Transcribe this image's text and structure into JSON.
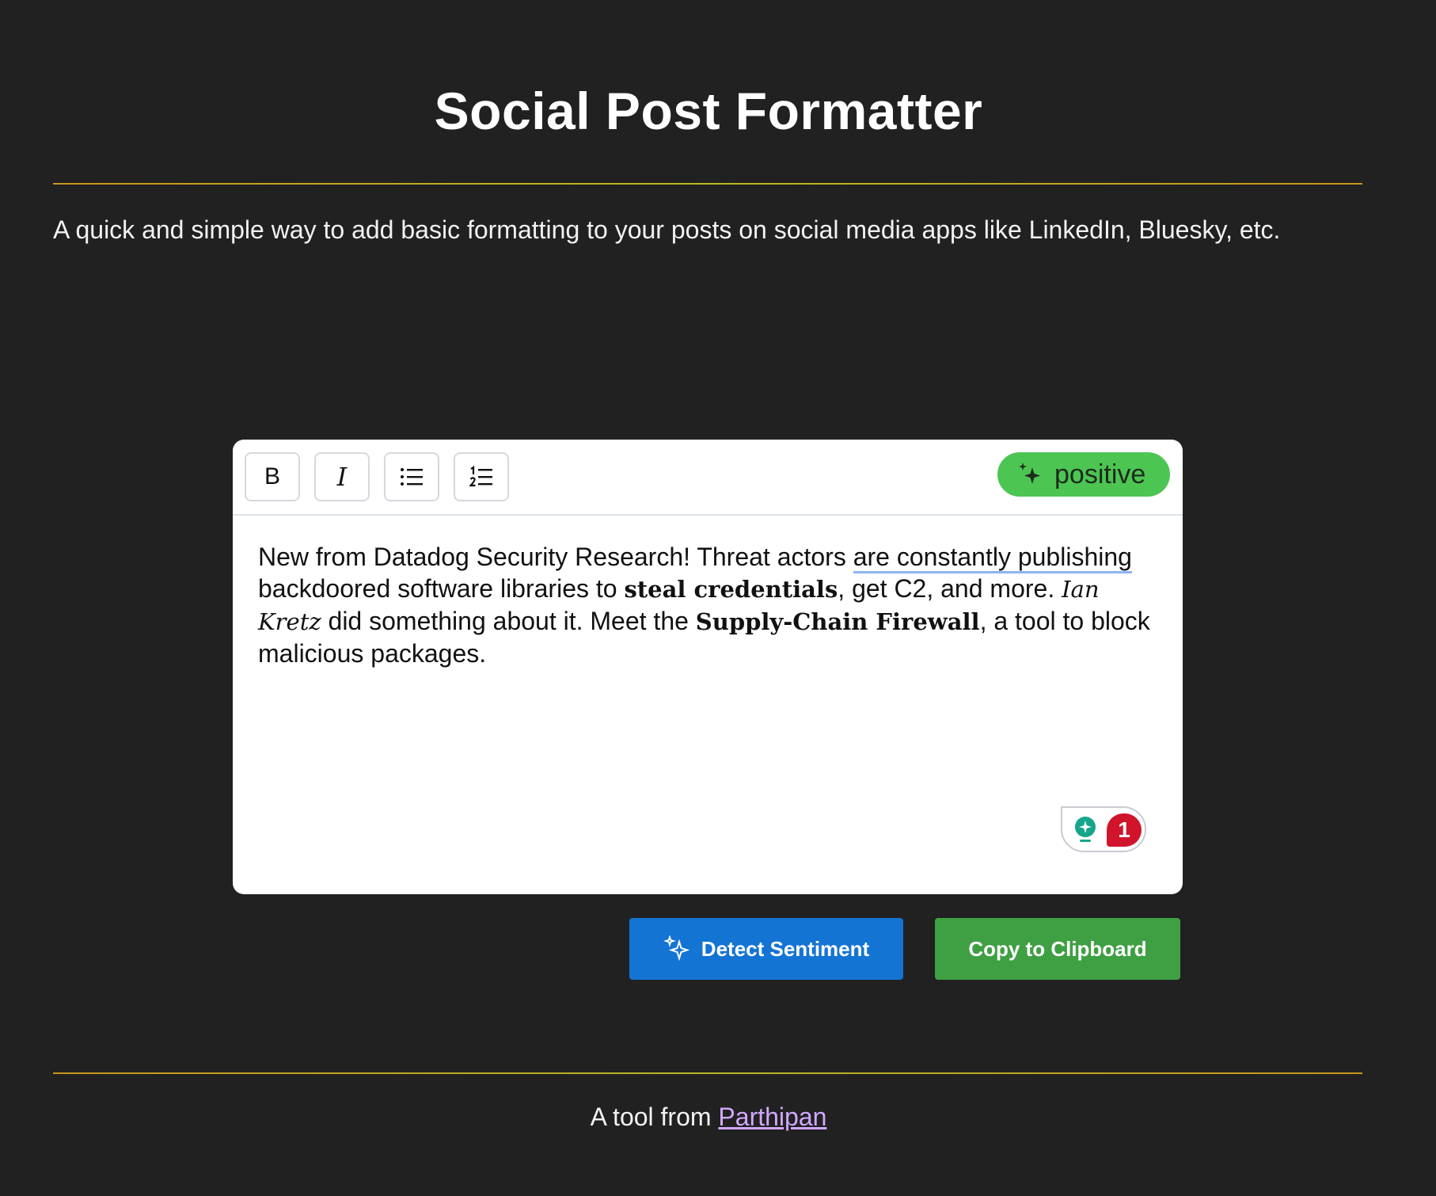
{
  "header": {
    "title": "Social Post Formatter",
    "subtitle": "A quick and simple way to add basic formatting to your posts on social media apps like LinkedIn, Bluesky, etc."
  },
  "toolbar": {
    "bold_label": "B",
    "italic_label": "I",
    "bulleted_list_icon": "bulleted-list-icon",
    "numbered_list_icon": "numbered-list-icon"
  },
  "sentiment": {
    "label": "positive",
    "icon": "sparkle-icon",
    "color": "#4cc552"
  },
  "editor": {
    "segments": [
      "New from Datadog Security Research! Threat actors ",
      "are constantly publishing",
      " backdoored software libraries to ",
      "steal credentials",
      ", get C2, and more. ",
      "Ian Kretz",
      " did something about it. Meet the ",
      "Supply-Chain Firewall",
      ", a tool to block malicious packages."
    ]
  },
  "grammar_widget": {
    "icon": "lightbulb-icon",
    "count": "1"
  },
  "actions": {
    "detect_label": "Detect Sentiment",
    "copy_label": "Copy to Clipboard",
    "detect_color": "#1474d4",
    "copy_color": "#3f9f43"
  },
  "footer": {
    "prefix": "A tool from ",
    "link_text": "Parthipan",
    "link_color": "#d2a8ff"
  }
}
